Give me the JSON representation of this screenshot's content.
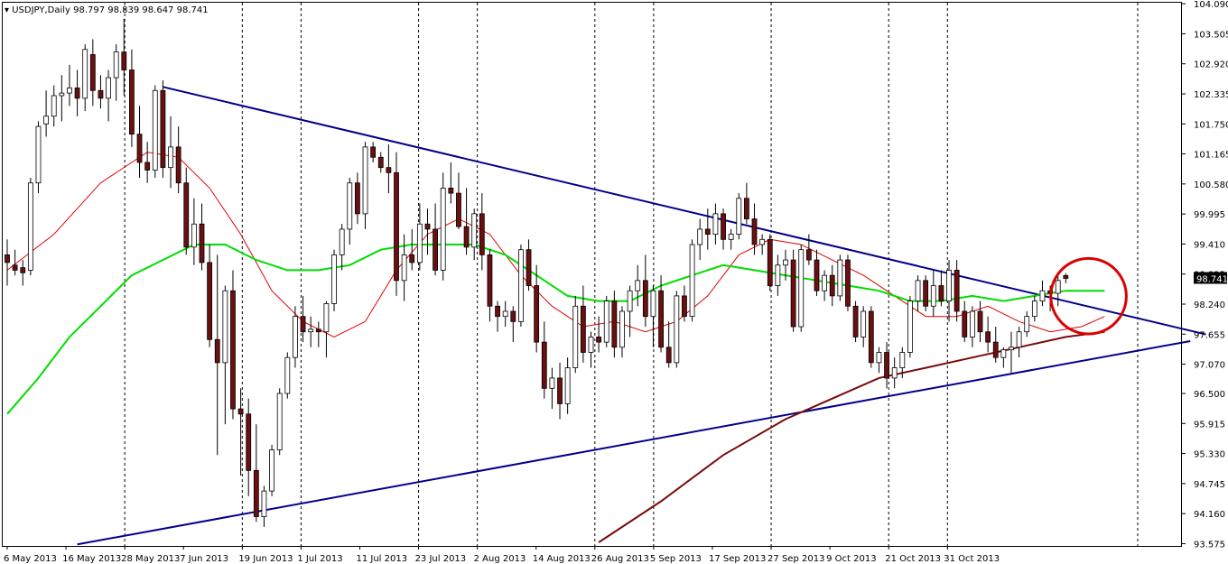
{
  "header": {
    "title": "▾ USDJPY,Daily  98.797 98.839 98.647 98.741"
  },
  "colors": {
    "background": "#ffffff",
    "frame": "#000000",
    "bull_candle": "#ffffff",
    "bear_candle": "#6b0f0f",
    "trend_line": "#00008b",
    "ma_fast": "#e00000",
    "ma_mid": "#00dd00",
    "ma_slow": "#7a0a0a",
    "highlight_circle": "#dd0000",
    "price_tag": "#000000"
  },
  "chart_data": {
    "type": "candlestick",
    "symbol": "USDJPY",
    "timeframe": "Daily",
    "ohlc_current": {
      "open": 98.797,
      "high": 98.839,
      "low": 98.647,
      "close": 98.741
    },
    "current_price_label": "98.741",
    "y_ticks": [
      "104.090",
      "103.505",
      "102.920",
      "102.335",
      "101.750",
      "101.165",
      "100.580",
      "99.995",
      "99.410",
      "98.825",
      "98.240",
      "97.655",
      "97.070",
      "96.500",
      "95.915",
      "95.330",
      "94.745",
      "94.160",
      "93.575"
    ],
    "ylim": [
      93.53,
      104.11
    ],
    "x_ticks": [
      "6 May 2013",
      "16 May 2013",
      "28 May 2013",
      "7 Jun 2013",
      "19 Jun 2013",
      "1 Jul 2013",
      "11 Jul 2013",
      "23 Jul 2013",
      "2 Aug 2013",
      "14 Aug 2013",
      "26 Aug 2013",
      "5 Sep 2013",
      "17 Sep 2013",
      "27 Sep 2013",
      "9 Oct 2013",
      "21 Oct 2013",
      "31 Oct 2013"
    ],
    "vertical_grid_after": [
      "28 May 2013",
      "19 Jun 2013",
      "1 Jul 2013",
      "23 Jul 2013",
      "2 Aug 2013",
      "26 Aug 2013",
      "5 Sep 2013",
      "27 Sep 2013",
      "21 Oct 2013",
      "31 Oct 2013"
    ],
    "candles": [
      [
        99.2,
        99.5,
        98.6,
        99.05
      ],
      [
        99.0,
        99.3,
        98.8,
        98.9
      ],
      [
        98.95,
        99.1,
        98.6,
        98.85
      ],
      [
        98.9,
        100.7,
        98.8,
        100.6
      ],
      [
        100.6,
        101.8,
        100.4,
        101.7
      ],
      [
        101.75,
        102.4,
        101.5,
        101.9
      ],
      [
        101.9,
        102.5,
        101.7,
        102.3
      ],
      [
        102.3,
        102.7,
        101.8,
        102.35
      ],
      [
        102.35,
        102.9,
        102.1,
        102.45
      ],
      [
        102.45,
        102.8,
        101.9,
        102.25
      ],
      [
        102.25,
        103.3,
        102.0,
        103.2
      ],
      [
        103.1,
        103.4,
        102.1,
        102.4
      ],
      [
        102.4,
        102.7,
        102.05,
        102.25
      ],
      [
        102.25,
        102.8,
        101.8,
        102.65
      ],
      [
        102.65,
        103.3,
        102.2,
        103.15
      ],
      [
        103.15,
        103.8,
        102.3,
        102.8
      ],
      [
        102.8,
        103.2,
        101.3,
        101.55
      ],
      [
        101.55,
        102.1,
        100.7,
        101.0
      ],
      [
        101.0,
        101.4,
        100.6,
        100.85
      ],
      [
        100.85,
        102.5,
        100.7,
        102.4
      ],
      [
        102.4,
        102.6,
        100.7,
        100.9
      ],
      [
        100.9,
        101.9,
        100.5,
        101.3
      ],
      [
        101.3,
        101.7,
        100.4,
        100.6
      ],
      [
        100.6,
        100.9,
        99.2,
        99.35
      ],
      [
        99.35,
        100.3,
        99.0,
        99.8
      ],
      [
        99.8,
        100.2,
        98.9,
        99.05
      ],
      [
        99.05,
        99.4,
        97.4,
        97.55
      ],
      [
        97.55,
        99.2,
        95.3,
        97.1
      ],
      [
        97.1,
        98.6,
        95.9,
        98.5
      ],
      [
        98.5,
        98.9,
        96.0,
        96.2
      ],
      [
        96.2,
        96.6,
        94.9,
        96.1
      ],
      [
        96.1,
        96.4,
        94.5,
        95.0
      ],
      [
        95.0,
        95.9,
        94.0,
        94.1
      ],
      [
        94.1,
        94.7,
        93.9,
        94.6
      ],
      [
        94.6,
        95.5,
        94.5,
        95.4
      ],
      [
        95.4,
        96.6,
        95.3,
        96.5
      ],
      [
        96.5,
        97.3,
        96.4,
        97.2
      ],
      [
        97.2,
        98.2,
        97.0,
        98.0
      ],
      [
        98.0,
        98.4,
        97.5,
        97.7
      ],
      [
        97.7,
        98.0,
        97.4,
        97.75
      ],
      [
        97.75,
        97.9,
        97.4,
        97.7
      ],
      [
        97.7,
        98.3,
        97.2,
        98.25
      ],
      [
        98.25,
        99.3,
        98.1,
        99.2
      ],
      [
        99.2,
        99.8,
        98.9,
        99.7
      ],
      [
        99.7,
        100.7,
        99.4,
        100.6
      ],
      [
        100.6,
        100.8,
        99.8,
        100.0
      ],
      [
        100.0,
        101.4,
        99.7,
        101.3
      ],
      [
        101.3,
        101.4,
        101.0,
        101.1
      ],
      [
        101.1,
        101.2,
        100.8,
        100.9
      ],
      [
        100.9,
        101.35,
        100.4,
        100.8
      ],
      [
        100.8,
        101.2,
        98.4,
        98.7
      ],
      [
        98.7,
        99.6,
        98.3,
        99.2
      ],
      [
        99.2,
        99.7,
        98.9,
        99.05
      ],
      [
        99.05,
        100.2,
        98.9,
        99.8
      ],
      [
        99.8,
        100.1,
        99.2,
        99.7
      ],
      [
        99.7,
        100.2,
        98.8,
        98.9
      ],
      [
        98.9,
        100.8,
        98.7,
        100.5
      ],
      [
        100.5,
        101.0,
        100.2,
        100.4
      ],
      [
        100.4,
        100.8,
        99.7,
        99.75
      ],
      [
        99.75,
        100.5,
        99.2,
        99.35
      ],
      [
        99.35,
        100.1,
        99.1,
        100.0
      ],
      [
        100.0,
        100.4,
        98.9,
        99.2
      ],
      [
        99.2,
        99.3,
        97.9,
        98.2
      ],
      [
        98.2,
        98.3,
        97.7,
        98.0
      ],
      [
        98.0,
        98.3,
        97.8,
        98.1
      ],
      [
        98.1,
        98.2,
        97.5,
        97.9
      ],
      [
        97.9,
        99.4,
        97.8,
        99.3
      ],
      [
        99.3,
        99.5,
        98.5,
        98.6
      ],
      [
        98.6,
        99.0,
        97.3,
        97.5
      ],
      [
        97.5,
        97.9,
        96.4,
        96.6
      ],
      [
        96.6,
        97.0,
        96.2,
        96.8
      ],
      [
        96.8,
        97.1,
        96.0,
        96.3
      ],
      [
        96.3,
        97.2,
        96.1,
        97.0
      ],
      [
        97.0,
        98.4,
        96.9,
        98.2
      ],
      [
        98.2,
        98.6,
        97.1,
        97.3
      ],
      [
        97.3,
        97.7,
        97.0,
        97.6
      ],
      [
        97.6,
        98.0,
        97.3,
        97.5
      ],
      [
        97.5,
        98.4,
        97.4,
        98.3
      ],
      [
        98.3,
        98.5,
        97.2,
        97.4
      ],
      [
        97.4,
        98.2,
        97.2,
        98.1
      ],
      [
        98.1,
        98.6,
        97.6,
        98.5
      ],
      [
        98.5,
        99.0,
        98.2,
        98.7
      ],
      [
        98.7,
        99.2,
        97.8,
        98.0
      ],
      [
        98.0,
        98.6,
        97.4,
        98.5
      ],
      [
        98.5,
        98.8,
        97.3,
        97.4
      ],
      [
        97.4,
        97.9,
        97.0,
        97.1
      ],
      [
        97.1,
        98.5,
        97.0,
        98.4
      ],
      [
        98.4,
        98.6,
        97.9,
        98.0
      ],
      [
        98.0,
        99.5,
        97.9,
        99.4
      ],
      [
        99.4,
        99.9,
        99.1,
        99.7
      ],
      [
        99.7,
        100.1,
        99.3,
        99.6
      ],
      [
        99.6,
        100.2,
        99.4,
        100.0
      ],
      [
        100.0,
        100.1,
        99.3,
        99.5
      ],
      [
        99.5,
        99.7,
        99.3,
        99.6
      ],
      [
        99.6,
        100.4,
        99.5,
        100.3
      ],
      [
        100.3,
        100.6,
        99.8,
        99.9
      ],
      [
        99.9,
        100.2,
        99.2,
        99.4
      ],
      [
        99.4,
        99.6,
        99.2,
        99.5
      ],
      [
        99.5,
        99.6,
        98.5,
        98.6
      ],
      [
        98.6,
        99.2,
        98.4,
        99.0
      ],
      [
        99.0,
        99.3,
        98.7,
        99.1
      ],
      [
        99.1,
        99.3,
        97.7,
        97.8
      ],
      [
        97.8,
        99.4,
        97.7,
        99.3
      ],
      [
        99.3,
        99.6,
        99.0,
        99.1
      ],
      [
        99.1,
        99.3,
        98.4,
        98.5
      ],
      [
        98.5,
        98.9,
        98.3,
        98.8
      ],
      [
        98.8,
        99.0,
        98.2,
        98.4
      ],
      [
        98.4,
        99.2,
        98.3,
        99.1
      ],
      [
        99.1,
        99.2,
        98.1,
        98.2
      ],
      [
        98.2,
        98.3,
        97.5,
        97.6
      ],
      [
        97.6,
        98.2,
        97.4,
        98.1
      ],
      [
        98.1,
        98.2,
        97.0,
        97.1
      ],
      [
        97.1,
        97.4,
        96.9,
        97.3
      ],
      [
        97.3,
        97.5,
        96.6,
        96.8
      ],
      [
        96.8,
        97.2,
        96.6,
        97.0
      ],
      [
        97.0,
        97.4,
        96.8,
        97.3
      ],
      [
        97.3,
        98.4,
        97.2,
        98.3
      ],
      [
        98.3,
        98.8,
        98.1,
        98.7
      ],
      [
        98.7,
        98.8,
        98.1,
        98.2
      ],
      [
        98.2,
        98.9,
        98.0,
        98.6
      ],
      [
        98.6,
        98.9,
        98.2,
        98.3
      ],
      [
        98.3,
        99.1,
        97.9,
        98.9
      ],
      [
        98.9,
        99.1,
        97.9,
        98.1
      ],
      [
        98.1,
        98.3,
        97.5,
        97.6
      ],
      [
        97.6,
        98.2,
        97.4,
        98.1
      ],
      [
        98.1,
        98.3,
        97.5,
        97.7
      ],
      [
        97.7,
        98.0,
        97.3,
        97.5
      ],
      [
        97.5,
        97.8,
        97.1,
        97.2
      ],
      [
        97.2,
        97.4,
        97.0,
        97.35
      ],
      [
        97.35,
        97.7,
        96.9,
        97.4
      ],
      [
        97.4,
        97.8,
        97.2,
        97.7
      ],
      [
        97.7,
        98.1,
        97.6,
        98.0
      ],
      [
        98.0,
        98.4,
        97.9,
        98.3
      ],
      [
        98.3,
        98.7,
        98.2,
        98.5
      ],
      [
        98.5,
        98.6,
        98.1,
        98.45
      ],
      [
        98.45,
        98.8,
        98.2,
        98.7
      ],
      [
        98.797,
        98.839,
        98.647,
        98.741
      ]
    ],
    "trendlines": [
      {
        "name": "upper",
        "from": [
          20,
          102.47
        ],
        "to": [
          154,
          97.65
        ]
      },
      {
        "name": "lower",
        "from": [
          9,
          93.56
        ],
        "to": [
          152,
          97.52
        ]
      }
    ],
    "moving_averages": [
      {
        "color_key": "ma_fast",
        "points": [
          [
            0,
            98.9
          ],
          [
            6,
            99.6
          ],
          [
            12,
            100.6
          ],
          [
            18,
            101.2
          ],
          [
            22,
            101.1
          ],
          [
            26,
            100.5
          ],
          [
            30,
            99.6
          ],
          [
            34,
            98.5
          ],
          [
            38,
            97.9
          ],
          [
            42,
            97.6
          ],
          [
            46,
            97.9
          ],
          [
            50,
            98.9
          ],
          [
            54,
            99.6
          ],
          [
            58,
            99.9
          ],
          [
            62,
            99.6
          ],
          [
            66,
            98.8
          ],
          [
            70,
            98.2
          ],
          [
            74,
            97.8
          ],
          [
            78,
            97.9
          ],
          [
            82,
            97.7
          ],
          [
            86,
            97.9
          ],
          [
            90,
            98.4
          ],
          [
            94,
            99.2
          ],
          [
            98,
            99.5
          ],
          [
            102,
            99.4
          ],
          [
            106,
            99.1
          ],
          [
            110,
            98.8
          ],
          [
            114,
            98.4
          ],
          [
            118,
            98.0
          ],
          [
            122,
            98.0
          ],
          [
            126,
            98.2
          ],
          [
            130,
            97.9
          ],
          [
            134,
            97.7
          ],
          [
            138,
            97.8
          ],
          [
            141,
            98.0
          ]
        ]
      },
      {
        "color_key": "ma_mid",
        "points": [
          [
            0,
            96.1
          ],
          [
            4,
            96.8
          ],
          [
            8,
            97.6
          ],
          [
            12,
            98.2
          ],
          [
            16,
            98.8
          ],
          [
            20,
            99.1
          ],
          [
            24,
            99.4
          ],
          [
            28,
            99.4
          ],
          [
            32,
            99.1
          ],
          [
            36,
            98.9
          ],
          [
            40,
            98.9
          ],
          [
            44,
            99.0
          ],
          [
            48,
            99.3
          ],
          [
            52,
            99.4
          ],
          [
            56,
            99.4
          ],
          [
            60,
            99.4
          ],
          [
            64,
            99.2
          ],
          [
            68,
            98.8
          ],
          [
            72,
            98.4
          ],
          [
            76,
            98.3
          ],
          [
            80,
            98.3
          ],
          [
            84,
            98.6
          ],
          [
            88,
            98.8
          ],
          [
            92,
            99.0
          ],
          [
            96,
            98.9
          ],
          [
            100,
            98.8
          ],
          [
            104,
            98.7
          ],
          [
            108,
            98.6
          ],
          [
            112,
            98.5
          ],
          [
            116,
            98.3
          ],
          [
            120,
            98.3
          ],
          [
            124,
            98.4
          ],
          [
            128,
            98.3
          ],
          [
            132,
            98.4
          ],
          [
            136,
            98.5
          ],
          [
            141,
            98.5
          ]
        ]
      },
      {
        "color_key": "ma_slow",
        "points": [
          [
            76,
            93.6
          ],
          [
            84,
            94.4
          ],
          [
            92,
            95.3
          ],
          [
            100,
            96.0
          ],
          [
            106,
            96.4
          ],
          [
            112,
            96.8
          ],
          [
            118,
            97.0
          ],
          [
            124,
            97.2
          ],
          [
            130,
            97.4
          ],
          [
            136,
            97.6
          ],
          [
            141,
            97.7
          ]
        ]
      }
    ],
    "highlight": {
      "center": [
        138,
        98.5
      ],
      "radius_units": 0.7
    }
  }
}
